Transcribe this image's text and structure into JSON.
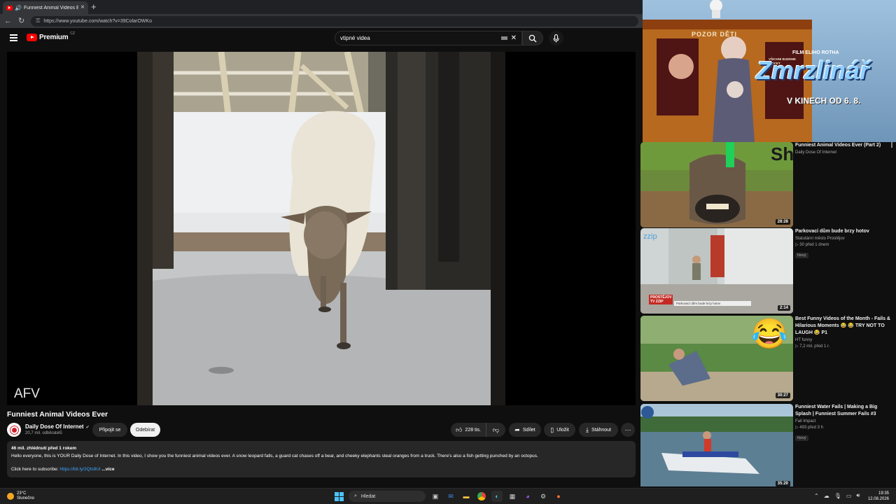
{
  "browser": {
    "tab_title": "Funniest Animal Videos Ever",
    "url": "https://www.youtube.com/watch?v=39ColarOWKo"
  },
  "masthead": {
    "logo_text": "Premium",
    "logo_country": "CZ",
    "search_query": "vtipné videa"
  },
  "player": {
    "watermark": "AFV"
  },
  "video": {
    "title": "Funniest Animal Videos Ever",
    "channel": "Daily Dose Of Internet",
    "subscribers": "20,7 mil. odběratelů",
    "join_label": "Připojit se",
    "subscribe_label": "Odebírat",
    "likes": "228 tis.",
    "share_label": "Sdílet",
    "save_label": "Uložit",
    "download_label": "Stáhnout",
    "description": {
      "meta": "46 mil. zhlédnutí  před 1 rokem",
      "text": "Hello everyone, this is YOUR Daily Dose of Internet. In this video, I show you the funniest animal videos ever. A snow leopard falls, a guard cat chases off a bear, and cheeky elephants steal oranges from a truck. There's also a fish getting punched by an octopus.",
      "subscribe_prefix": "Click here to subscribe: ",
      "subscribe_link": "https://bit.ly/2Qts9Ui",
      "more": "...více"
    }
  },
  "ad": {
    "sign": "POZOR DĚTI",
    "sign_small": "VŠICHNI BUDEME KRICET",
    "film_line": "FILM ELIHO ROTHA",
    "movie_title": "Zmrzlinář",
    "release": "V KINECH OD 6. 8."
  },
  "recommendations": [
    {
      "title": "Funniest Animal Videos Ever (Part 2)",
      "channel": "Daily Dose Of Internet",
      "meta": "",
      "duration": "28:28",
      "badge": "",
      "overlay": "Shutterstock"
    },
    {
      "title": "Parkovací dům bude brzy hotov",
      "channel": "Statutární město Prostějov",
      "meta": "30  před 1 dnem",
      "duration": "2:14",
      "badge": "Nový",
      "overlay": "PROSTĚJOV TV ZZIP",
      "overlay_caption": "Parkovací dům bude brzy hotov",
      "overlay_logo": "zzip"
    },
    {
      "title": "Best Funny Videos of the Month - Fails & Hilarious Moments 😂 😂 TRY NOT TO LAUGH 😂 P1",
      "channel": "HT funny",
      "meta": "7,2 mil.  před 1 r.",
      "duration": "30:27",
      "badge": "",
      "overlay": "😂"
    },
    {
      "title": "Funniest Water Fails | Making a Big Splash | Funniest Summer Fails #3",
      "channel": "Fail Impact",
      "meta": "493  před 3 h",
      "duration": "35:20",
      "badge": "Nový",
      "overlay": ""
    }
  ],
  "taskbar": {
    "temperature": "23°C",
    "weather": "Slunečno",
    "search_label": "Hledat",
    "time": "19:35",
    "date": "12.08.2026"
  },
  "colors": {
    "youtube_red": "#ff0000",
    "background": "#0f0f0f",
    "link": "#3ea6ff"
  }
}
